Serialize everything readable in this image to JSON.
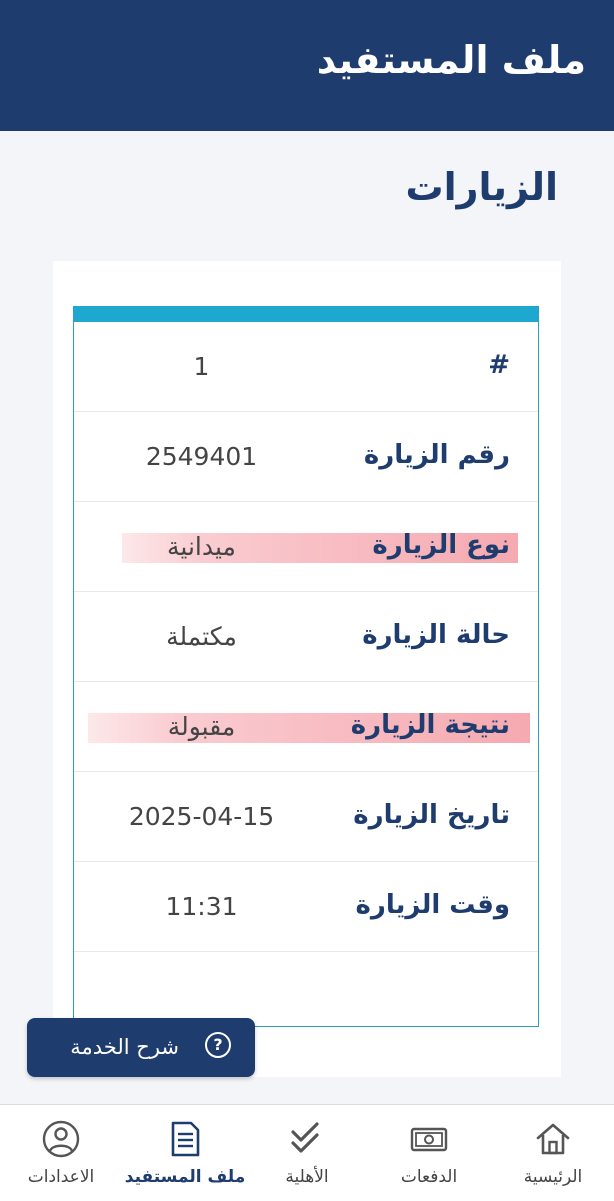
{
  "header": {
    "title": "ملف المستفيد"
  },
  "section": {
    "title": "الزيارات"
  },
  "visit": {
    "rows": [
      {
        "label": "#",
        "value": "1"
      },
      {
        "label": "رقم الزيارة",
        "value": "2549401"
      },
      {
        "label": "نوع الزيارة",
        "value": "ميدانية"
      },
      {
        "label": "حالة الزيارة",
        "value": "مكتملة"
      },
      {
        "label": "نتيجة الزيارة",
        "value": "مقبولة"
      },
      {
        "label": "تاريخ الزيارة",
        "value": "2025-04-15"
      },
      {
        "label": "وقت الزيارة",
        "value": "11:31"
      }
    ]
  },
  "help": {
    "label": "شرح الخدمة",
    "icon": "question-circle-icon"
  },
  "nav": {
    "items": [
      {
        "label": "الرئيسية",
        "icon": "home-icon"
      },
      {
        "label": "الدفعات",
        "icon": "banknote-icon"
      },
      {
        "label": "الأهلية",
        "icon": "double-check-icon"
      },
      {
        "label": "ملف المستفيد",
        "icon": "document-icon",
        "active": true
      },
      {
        "label": "الاعدادات",
        "icon": "user-circle-icon"
      }
    ]
  },
  "colors": {
    "primary": "#1f3c6e",
    "accent": "#1ea8d0",
    "highlight": "#f28c96",
    "background": "#f4f5f9"
  }
}
